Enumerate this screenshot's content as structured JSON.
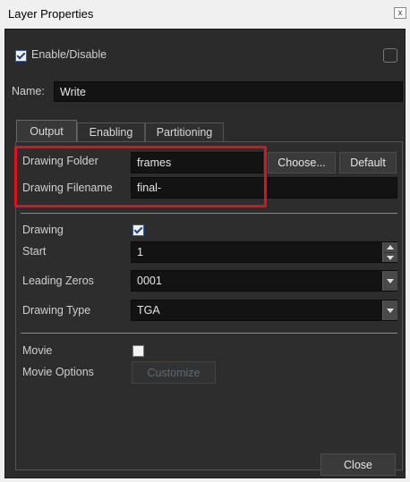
{
  "window": {
    "title": "Layer Properties",
    "close_glyph": "x"
  },
  "enable": {
    "label": "Enable/Disable",
    "checked": true,
    "color_swatch_checked": false
  },
  "name": {
    "label": "Name:",
    "value": "Write"
  },
  "tabs": [
    {
      "label": "Output",
      "active": true
    },
    {
      "label": "Enabling",
      "active": false
    },
    {
      "label": "Partitioning",
      "active": false
    }
  ],
  "output": {
    "drawing_folder": {
      "label": "Drawing Folder",
      "value": "frames"
    },
    "drawing_filename": {
      "label": "Drawing Filename",
      "value": "final-"
    },
    "choose_label": "Choose...",
    "default_label": "Default",
    "drawing": {
      "label": "Drawing",
      "checked": true
    },
    "start": {
      "label": "Start",
      "value": "1"
    },
    "leading_zeros": {
      "label": "Leading Zeros",
      "value": "0001"
    },
    "drawing_type": {
      "label": "Drawing Type",
      "value": "TGA"
    },
    "movie": {
      "label": "Movie",
      "checked": false
    },
    "movie_options": {
      "label": "Movie Options",
      "button_label": "Customize"
    }
  },
  "footer": {
    "close_label": "Close"
  },
  "colors": {
    "highlight_box": "#d9141c",
    "panel_bg": "#2b2b2b",
    "field_bg": "#131313"
  }
}
